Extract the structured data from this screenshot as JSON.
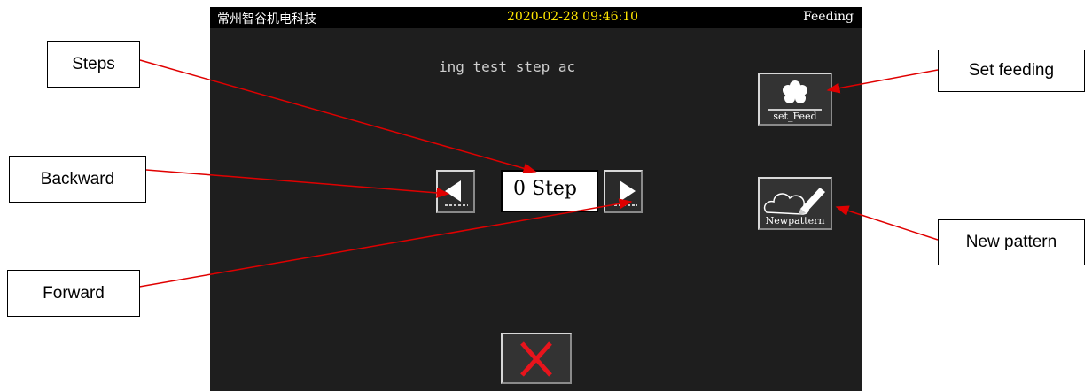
{
  "status_bar": {
    "company": "常州智谷机电科技",
    "datetime": "2020-02-28 09:46:10",
    "mode": "Feeding"
  },
  "message": "ing test step ac",
  "step_display": "0 Step",
  "buttons": {
    "set_feed_label": "set_Feed",
    "new_pattern_label": "Newpattern"
  },
  "callouts": {
    "steps": "Steps",
    "backward": "Backward",
    "forward": "Forward",
    "set_feeding": "Set feeding",
    "new_pattern": "New pattern"
  },
  "colors": {
    "screen_bg": "#1e1e1e",
    "status_bg": "#000000",
    "datetime": "#ffe600",
    "annotation": "#e00000",
    "close_x": "#e8141c"
  },
  "icons": {
    "backward": "left-triangle-icon",
    "forward": "right-triangle-icon",
    "set_feed": "flower-icon",
    "new_pattern": "cloud-pencil-icon",
    "close": "close-x-icon"
  }
}
